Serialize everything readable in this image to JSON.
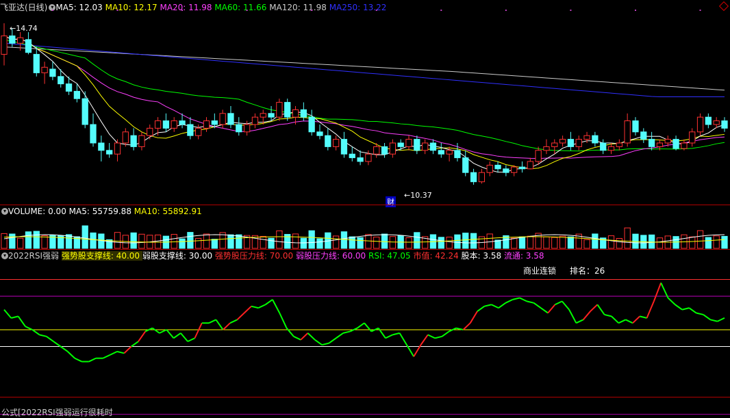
{
  "window_title": "飞亚达(日线)",
  "price_panel": {
    "legend": [
      {
        "label": "MA5: 12.03",
        "color": "#ffffff"
      },
      {
        "label": "MA10: 12.17",
        "color": "#ffff00"
      },
      {
        "label": "MA20: 11.98",
        "color": "#ff40ff"
      },
      {
        "label": "MA60: 11.66",
        "color": "#00ff00"
      },
      {
        "label": "MA120: 11.98",
        "color": "#cccccc"
      },
      {
        "label": "MA250: 13.22",
        "color": "#3030ff"
      }
    ],
    "high_label": "14.74",
    "low_label": "10.37",
    "fin_badge": "财"
  },
  "volume_panel": {
    "legend": [
      {
        "label": "VOLUME: 0.00",
        "color": "#ffffff"
      },
      {
        "label": "MA5: 55759.88",
        "color": "#ffffff"
      },
      {
        "label": "MA10: 55892.91",
        "color": "#ffff00"
      }
    ]
  },
  "rsi_panel": {
    "legend": [
      {
        "label": "2022RSI强弱",
        "color": "#cccccc"
      },
      {
        "label": "强势股支撑线: 40.00",
        "color": "#ffff00",
        "hl": true
      },
      {
        "label": "弱股支撑线: 30.00",
        "color": "#ffffff"
      },
      {
        "label": "强势股压力线: 70.00",
        "color": "#ff3030"
      },
      {
        "label": "弱股压力线: 60.00",
        "color": "#ff40ff"
      },
      {
        "label": "RSI: 47.05",
        "color": "#00ff00"
      },
      {
        "label": "市值: 42.24",
        "color": "#ff3030"
      },
      {
        "label": "股本: 3.58",
        "color": "#ffffff"
      },
      {
        "label": "流通: 3.58",
        "color": "#ff40ff"
      }
    ],
    "sector_label": "商业连锁",
    "rank_label": "排名：",
    "rank_value": "26"
  },
  "footer": {
    "formula": "公式[2022RSI强弱运行很耗时"
  },
  "chart_data": {
    "type": "candlestick",
    "candles": [
      {
        "o": 13.9,
        "h": 14.74,
        "l": 13.6,
        "c": 14.4
      },
      {
        "o": 14.4,
        "h": 14.6,
        "l": 14.1,
        "c": 14.2
      },
      {
        "o": 14.2,
        "h": 14.5,
        "l": 14.0,
        "c": 14.35
      },
      {
        "o": 14.3,
        "h": 14.5,
        "l": 13.9,
        "c": 13.95
      },
      {
        "o": 13.9,
        "h": 14.1,
        "l": 13.3,
        "c": 13.4
      },
      {
        "o": 13.4,
        "h": 13.7,
        "l": 13.1,
        "c": 13.55
      },
      {
        "o": 13.5,
        "h": 13.7,
        "l": 13.2,
        "c": 13.3
      },
      {
        "o": 13.3,
        "h": 13.5,
        "l": 13.0,
        "c": 13.1
      },
      {
        "o": 13.1,
        "h": 13.3,
        "l": 12.8,
        "c": 12.9
      },
      {
        "o": 12.9,
        "h": 13.1,
        "l": 12.6,
        "c": 12.7
      },
      {
        "o": 12.7,
        "h": 12.9,
        "l": 11.9,
        "c": 12.0
      },
      {
        "o": 12.0,
        "h": 12.3,
        "l": 11.4,
        "c": 11.5
      },
      {
        "o": 11.5,
        "h": 11.7,
        "l": 11.0,
        "c": 11.3
      },
      {
        "o": 11.3,
        "h": 11.5,
        "l": 11.1,
        "c": 11.2
      },
      {
        "o": 11.2,
        "h": 11.6,
        "l": 11.0,
        "c": 11.5
      },
      {
        "o": 11.5,
        "h": 11.9,
        "l": 11.4,
        "c": 11.8
      },
      {
        "o": 11.7,
        "h": 11.9,
        "l": 11.3,
        "c": 11.4
      },
      {
        "o": 11.4,
        "h": 11.8,
        "l": 11.3,
        "c": 11.7
      },
      {
        "o": 11.7,
        "h": 12.0,
        "l": 11.6,
        "c": 11.9
      },
      {
        "o": 11.9,
        "h": 12.2,
        "l": 11.7,
        "c": 12.1
      },
      {
        "o": 12.1,
        "h": 12.3,
        "l": 11.8,
        "c": 11.9
      },
      {
        "o": 11.9,
        "h": 12.2,
        "l": 11.8,
        "c": 12.1
      },
      {
        "o": 12.1,
        "h": 12.3,
        "l": 11.9,
        "c": 12.0
      },
      {
        "o": 12.0,
        "h": 12.2,
        "l": 11.6,
        "c": 11.7
      },
      {
        "o": 11.7,
        "h": 12.0,
        "l": 11.6,
        "c": 11.9
      },
      {
        "o": 11.9,
        "h": 12.2,
        "l": 11.8,
        "c": 12.1
      },
      {
        "o": 12.1,
        "h": 12.3,
        "l": 11.9,
        "c": 12.0
      },
      {
        "o": 12.0,
        "h": 12.4,
        "l": 11.9,
        "c": 12.3
      },
      {
        "o": 12.3,
        "h": 12.5,
        "l": 11.9,
        "c": 12.0
      },
      {
        "o": 12.0,
        "h": 12.2,
        "l": 11.7,
        "c": 11.8
      },
      {
        "o": 11.8,
        "h": 12.1,
        "l": 11.7,
        "c": 12.0
      },
      {
        "o": 12.0,
        "h": 12.3,
        "l": 11.9,
        "c": 12.2
      },
      {
        "o": 12.2,
        "h": 12.4,
        "l": 12.0,
        "c": 12.3
      },
      {
        "o": 12.3,
        "h": 12.5,
        "l": 12.1,
        "c": 12.2
      },
      {
        "o": 12.2,
        "h": 12.7,
        "l": 12.1,
        "c": 12.6
      },
      {
        "o": 12.6,
        "h": 12.7,
        "l": 12.1,
        "c": 12.2
      },
      {
        "o": 12.2,
        "h": 12.5,
        "l": 12.0,
        "c": 12.4
      },
      {
        "o": 12.4,
        "h": 12.6,
        "l": 12.1,
        "c": 12.2
      },
      {
        "o": 12.2,
        "h": 12.4,
        "l": 11.7,
        "c": 11.8
      },
      {
        "o": 11.8,
        "h": 12.0,
        "l": 11.6,
        "c": 11.7
      },
      {
        "o": 11.7,
        "h": 11.9,
        "l": 11.3,
        "c": 11.4
      },
      {
        "o": 11.4,
        "h": 11.7,
        "l": 11.3,
        "c": 11.6
      },
      {
        "o": 11.6,
        "h": 11.8,
        "l": 11.1,
        "c": 11.2
      },
      {
        "o": 11.2,
        "h": 11.4,
        "l": 11.0,
        "c": 11.1
      },
      {
        "o": 11.1,
        "h": 11.3,
        "l": 10.9,
        "c": 11.0
      },
      {
        "o": 11.0,
        "h": 11.3,
        "l": 10.9,
        "c": 11.2
      },
      {
        "o": 11.2,
        "h": 11.5,
        "l": 11.1,
        "c": 11.4
      },
      {
        "o": 11.4,
        "h": 11.5,
        "l": 11.1,
        "c": 11.2
      },
      {
        "o": 11.2,
        "h": 11.6,
        "l": 11.1,
        "c": 11.5
      },
      {
        "o": 11.5,
        "h": 11.6,
        "l": 11.3,
        "c": 11.4
      },
      {
        "o": 11.4,
        "h": 11.7,
        "l": 11.3,
        "c": 11.6
      },
      {
        "o": 11.6,
        "h": 11.7,
        "l": 11.2,
        "c": 11.3
      },
      {
        "o": 11.3,
        "h": 11.6,
        "l": 11.2,
        "c": 11.5
      },
      {
        "o": 11.5,
        "h": 11.6,
        "l": 11.2,
        "c": 11.3
      },
      {
        "o": 11.3,
        "h": 11.5,
        "l": 11.1,
        "c": 11.2
      },
      {
        "o": 11.2,
        "h": 11.4,
        "l": 11.0,
        "c": 11.3
      },
      {
        "o": 11.3,
        "h": 11.5,
        "l": 11.0,
        "c": 11.1
      },
      {
        "o": 11.1,
        "h": 11.3,
        "l": 10.6,
        "c": 10.7
      },
      {
        "o": 10.7,
        "h": 10.8,
        "l": 10.37,
        "c": 10.45
      },
      {
        "o": 10.45,
        "h": 10.8,
        "l": 10.4,
        "c": 10.7
      },
      {
        "o": 10.7,
        "h": 11.0,
        "l": 10.6,
        "c": 10.9
      },
      {
        "o": 10.9,
        "h": 11.0,
        "l": 10.7,
        "c": 10.8
      },
      {
        "o": 10.8,
        "h": 10.9,
        "l": 10.6,
        "c": 10.7
      },
      {
        "o": 10.7,
        "h": 10.9,
        "l": 10.6,
        "c": 10.85
      },
      {
        "o": 10.85,
        "h": 11.0,
        "l": 10.7,
        "c": 10.8
      },
      {
        "o": 10.8,
        "h": 11.1,
        "l": 10.8,
        "c": 11.0
      },
      {
        "o": 11.0,
        "h": 11.4,
        "l": 10.9,
        "c": 11.3
      },
      {
        "o": 11.3,
        "h": 11.6,
        "l": 11.2,
        "c": 11.4
      },
      {
        "o": 11.4,
        "h": 11.6,
        "l": 11.2,
        "c": 11.5
      },
      {
        "o": 11.5,
        "h": 11.7,
        "l": 11.4,
        "c": 11.6
      },
      {
        "o": 11.6,
        "h": 11.8,
        "l": 11.3,
        "c": 11.4
      },
      {
        "o": 11.4,
        "h": 11.7,
        "l": 11.3,
        "c": 11.6
      },
      {
        "o": 11.6,
        "h": 11.8,
        "l": 11.5,
        "c": 11.7
      },
      {
        "o": 11.7,
        "h": 11.8,
        "l": 11.4,
        "c": 11.5
      },
      {
        "o": 11.5,
        "h": 11.6,
        "l": 11.2,
        "c": 11.3
      },
      {
        "o": 11.3,
        "h": 11.5,
        "l": 11.2,
        "c": 11.4
      },
      {
        "o": 11.4,
        "h": 11.6,
        "l": 11.3,
        "c": 11.5
      },
      {
        "o": 11.5,
        "h": 12.3,
        "l": 11.4,
        "c": 12.1
      },
      {
        "o": 12.1,
        "h": 12.2,
        "l": 11.7,
        "c": 11.8
      },
      {
        "o": 11.8,
        "h": 11.9,
        "l": 11.5,
        "c": 11.6
      },
      {
        "o": 11.6,
        "h": 11.8,
        "l": 11.3,
        "c": 11.4
      },
      {
        "o": 11.4,
        "h": 11.6,
        "l": 11.3,
        "c": 11.5
      },
      {
        "o": 11.5,
        "h": 11.7,
        "l": 11.4,
        "c": 11.6
      },
      {
        "o": 11.6,
        "h": 11.7,
        "l": 11.3,
        "c": 11.35
      },
      {
        "o": 11.35,
        "h": 11.6,
        "l": 11.3,
        "c": 11.5
      },
      {
        "o": 11.5,
        "h": 11.9,
        "l": 11.4,
        "c": 11.8
      },
      {
        "o": 11.8,
        "h": 12.3,
        "l": 11.7,
        "c": 12.2
      },
      {
        "o": 12.2,
        "h": 12.3,
        "l": 11.9,
        "c": 12.0
      },
      {
        "o": 12.0,
        "h": 12.2,
        "l": 11.9,
        "c": 12.1
      },
      {
        "o": 12.1,
        "h": 12.2,
        "l": 11.8,
        "c": 11.9
      }
    ],
    "ma": {
      "ma5": "#ffffff",
      "ma10": "#ffff00",
      "ma20": "#ff40ff",
      "ma60": "#00ff00",
      "ma120": "#cccccc",
      "ma250": "#3030ff"
    },
    "rsi": [
      52,
      47,
      48,
      42,
      40,
      37,
      36,
      33,
      30,
      27,
      23,
      21,
      21,
      23,
      23,
      25,
      27,
      26,
      30,
      33,
      39,
      41,
      38,
      40,
      35,
      38,
      33,
      35,
      44,
      44,
      46,
      40,
      44,
      46,
      50,
      54,
      53,
      55,
      58,
      50,
      41,
      36,
      34,
      38,
      34,
      31,
      32,
      35,
      38,
      39,
      41,
      44,
      39,
      41,
      35,
      37,
      38,
      31,
      24,
      31,
      37,
      35,
      36,
      39,
      41,
      40,
      44,
      51,
      54,
      55,
      53,
      56,
      58,
      59,
      57,
      56,
      53,
      50,
      55,
      57,
      52,
      44,
      46,
      51,
      55,
      49,
      48,
      44,
      46,
      44,
      48,
      47,
      57,
      68,
      59,
      55,
      52,
      53,
      50,
      49,
      46,
      45,
      47.05
    ],
    "rsi_lines": {
      "strong_support": 40,
      "weak_support": 30,
      "strong_pressure": 70,
      "weak_pressure": 60
    },
    "price_range": [
      10.0,
      15.0
    ]
  }
}
